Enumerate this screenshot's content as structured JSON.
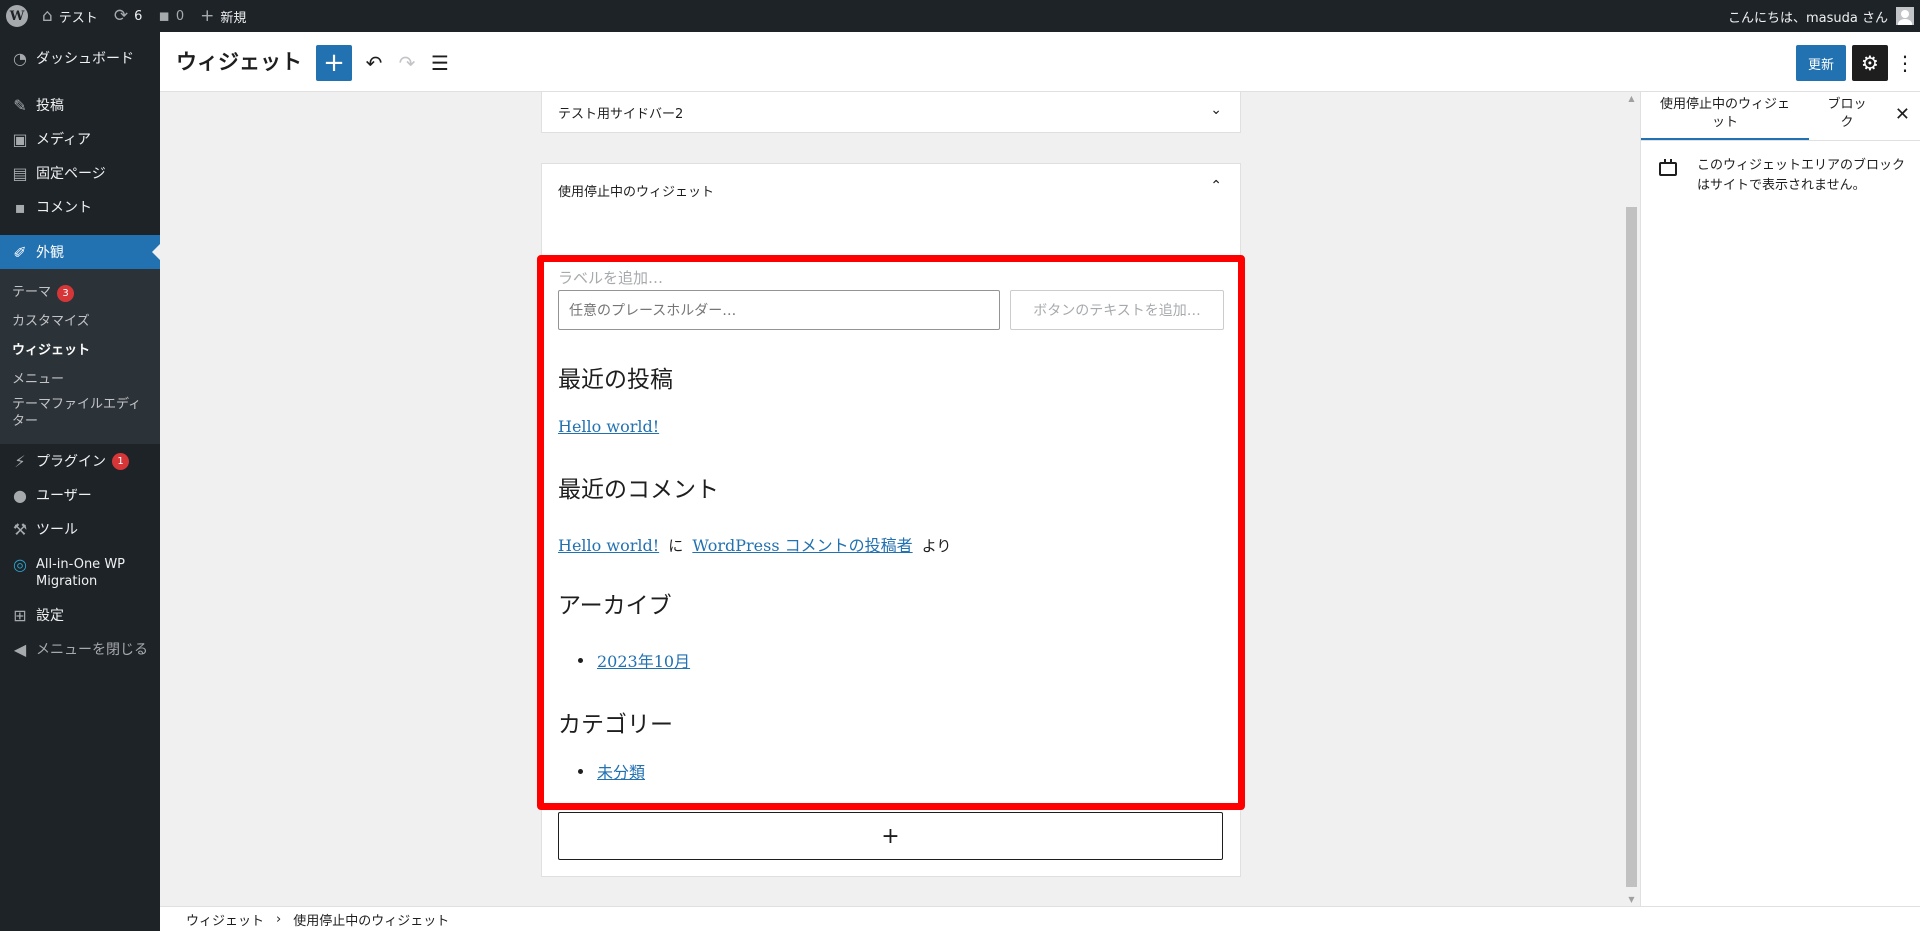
{
  "adminbar": {
    "site_name": "テスト",
    "updates_count": "6",
    "comments_count": "0",
    "new_label": "新規",
    "greeting": "こんにちは、masuda さん"
  },
  "menu": {
    "dashboard": "ダッシュボード",
    "posts": "投稿",
    "media": "メディア",
    "pages": "固定ページ",
    "comments": "コメント",
    "appearance": "外観",
    "plugins": "プラグイン",
    "plugins_badge": "1",
    "users": "ユーザー",
    "tools": "ツール",
    "aio_line1": "All-in-One WP",
    "aio_line2": "Migration",
    "settings": "設定",
    "collapse": "メニューを閉じる"
  },
  "submenu": {
    "themes": "テーマ",
    "themes_badge": "3",
    "customize": "カスタマイズ",
    "widgets": "ウィジェット",
    "menus": "メニュー",
    "theme_editor_line1": "テーマファイルエディ",
    "theme_editor_line2": "ター"
  },
  "header": {
    "title": "ウィジェット",
    "update_label": "更新"
  },
  "canvas": {
    "sidebar2_title": "テスト用サイドバー2",
    "inactive_title": "使用停止中のウィジェット",
    "search_label": "ラベルを追加…",
    "search_placeholder": "任意のプレースホルダー…",
    "search_button": "ボタンのテキストを追加…",
    "recent_posts_heading": "最近の投稿",
    "recent_post_link": "Hello world!",
    "recent_comments_heading": "最近のコメント",
    "comment_post_link": "Hello world!",
    "comment_on": "に",
    "comment_author_link": "WordPress コメントの投稿者",
    "comment_from": "より",
    "archives_heading": "アーカイブ",
    "archive_item": "2023年10月",
    "categories_heading": "カテゴリー",
    "category_item": "未分類",
    "appender_label": "+"
  },
  "footer": {
    "crumb1": "ウィジェット",
    "crumb2": "使用停止中のウィジェット"
  },
  "sidebar": {
    "tab_area_line1": "使用停止中のウィジェ",
    "tab_area_line2": "ット",
    "tab_block_line1": "ブロッ",
    "tab_block_line2": "ク",
    "description": "このウィジェットエリアのブロックはサイトで表示されません。"
  },
  "colors": {
    "accent": "#2271b1",
    "admin_dark": "#1d2327",
    "highlight": "#ff0000",
    "badge": "#d63638"
  }
}
